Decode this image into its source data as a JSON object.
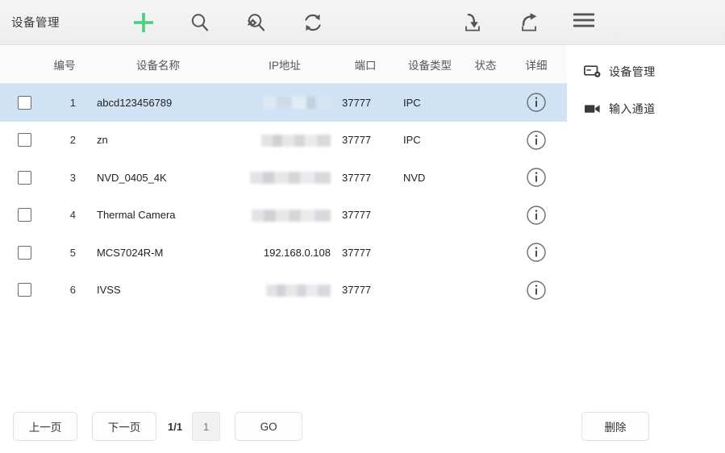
{
  "app": {
    "title": "设备管理"
  },
  "toolbar": {
    "buttons": [
      {
        "name": "add",
        "icon": "plus-icon",
        "color": "#4ad07d"
      },
      {
        "name": "search",
        "icon": "search-icon",
        "color": "#555555"
      },
      {
        "name": "config-search",
        "icon": "search-gear-icon",
        "color": "#555555"
      },
      {
        "name": "refresh",
        "icon": "refresh-icon",
        "color": "#555555"
      },
      {
        "name": "import",
        "icon": "import-icon",
        "color": "#555555"
      },
      {
        "name": "export",
        "icon": "export-icon",
        "color": "#555555"
      }
    ],
    "menu_icon": "hamburger-menu-icon"
  },
  "table": {
    "columns": [
      {
        "key": "checkbox",
        "label": ""
      },
      {
        "key": "no",
        "label": "编号"
      },
      {
        "key": "name",
        "label": "设备名称"
      },
      {
        "key": "ip",
        "label": "IP地址"
      },
      {
        "key": "port",
        "label": "端口"
      },
      {
        "key": "type",
        "label": "设备类型"
      },
      {
        "key": "status",
        "label": "状态"
      },
      {
        "key": "detail",
        "label": "详细"
      }
    ],
    "rows": [
      {
        "no": "1",
        "name": "abcd123456789",
        "ip": "",
        "ip_redacted": true,
        "ip_width": 84,
        "port": "37777",
        "type": "IPC",
        "status": "",
        "selected": true,
        "checked": false
      },
      {
        "no": "2",
        "name": "zn",
        "ip": "",
        "ip_redacted": true,
        "ip_width": 86,
        "port": "37777",
        "type": "IPC",
        "status": "",
        "selected": false,
        "checked": false
      },
      {
        "no": "3",
        "name": "NVD_0405_4K",
        "ip": "",
        "ip_redacted": true,
        "ip_width": 100,
        "port": "37777",
        "type": "NVD",
        "status": "",
        "selected": false,
        "checked": false
      },
      {
        "no": "4",
        "name": "Thermal Camera",
        "ip": "",
        "ip_redacted": true,
        "ip_width": 98,
        "port": "37777",
        "type": "",
        "status": "",
        "selected": false,
        "checked": false
      },
      {
        "no": "5",
        "name": "MCS7024R-M",
        "ip": "192.168.0.108",
        "ip_redacted": false,
        "ip_width": 0,
        "port": "37777",
        "type": "",
        "status": "",
        "selected": false,
        "checked": false
      },
      {
        "no": "6",
        "name": "IVSS",
        "ip": "",
        "ip_redacted": true,
        "ip_width": 80,
        "port": "37777",
        "type": "",
        "status": "",
        "selected": false,
        "checked": false
      }
    ],
    "detail_icon": "info-icon"
  },
  "sidepanel": {
    "items": [
      {
        "label": "设备管理",
        "icon": "device-config-icon"
      },
      {
        "label": "输入通道",
        "icon": "video-camera-icon"
      }
    ]
  },
  "pagination": {
    "prev_label": "上一页",
    "next_label": "下一页",
    "page_indicator": "1/1",
    "page_input_placeholder": "1",
    "page_input_value": "",
    "go_label": "GO",
    "delete_label": "删除"
  },
  "colors": {
    "accent_add": "#4ad07d",
    "row_selected": "#cfe3f5",
    "topbar_bg": "#f1f1f1",
    "header_bg": "#fafafa"
  }
}
